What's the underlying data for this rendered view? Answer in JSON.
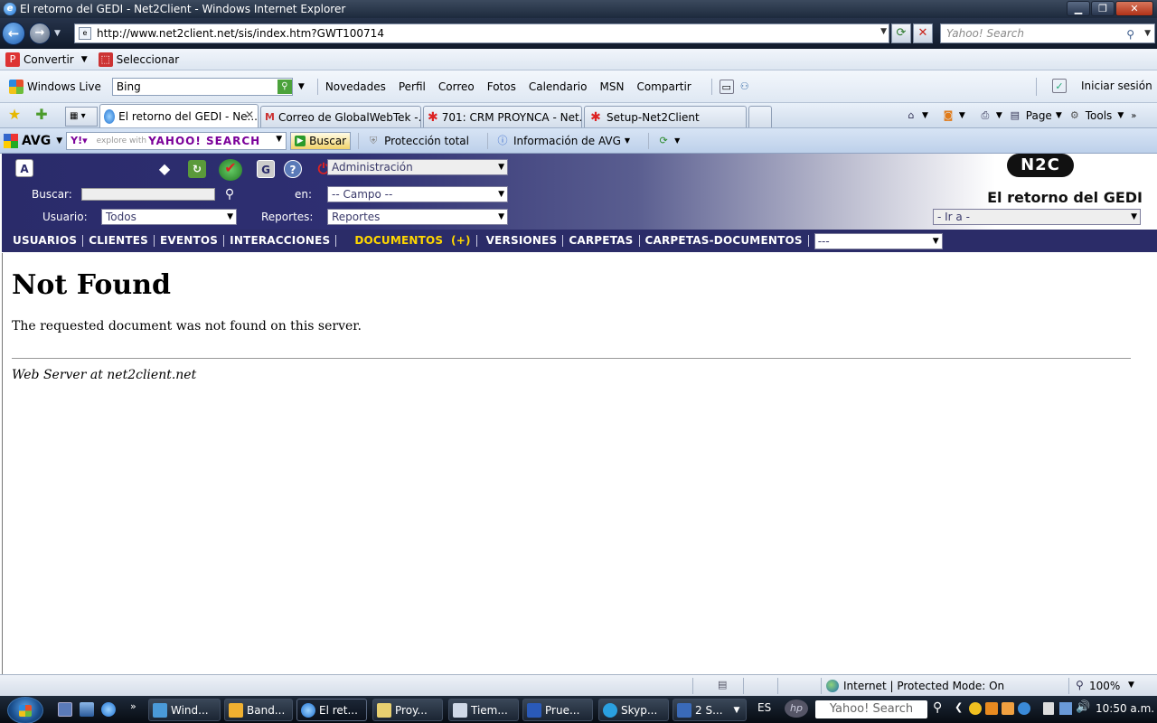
{
  "window": {
    "title": "El retorno del GEDI - Net2Client - Windows Internet Explorer"
  },
  "address": {
    "url": "http://www.net2client.net/sis/index.htm?GWT100714"
  },
  "search": {
    "placeholder": "Yahoo! Search"
  },
  "toolbar1": {
    "convert": "Convertir",
    "select": "Seleccionar"
  },
  "toolbar2": {
    "windows_live": "Windows Live",
    "bing": "Bing",
    "links": [
      "Novedades",
      "Perfil",
      "Correo",
      "Fotos",
      "Calendario",
      "MSN",
      "Compartir"
    ],
    "signin": "Iniciar sesión"
  },
  "tabs": [
    {
      "label": "El retorno del GEDI - Ne..."
    },
    {
      "label": "Correo de GlobalWebTek -..."
    },
    {
      "label": "701: CRM PROYNCA - Net..."
    },
    {
      "label": "Setup-Net2Client"
    }
  ],
  "ietools": {
    "page": "Page",
    "tools": "Tools"
  },
  "avg": {
    "brand": "AVG",
    "yahoo_explore": "explore with",
    "yahoo_logo": "YAHOO! SEARCH",
    "buscar": "Buscar",
    "proteccion": "Protección total",
    "info": "Información de AVG"
  },
  "app": {
    "title": "El retorno del GEDI",
    "logo": "N2C",
    "admin_select": "Administración",
    "buscar_label": "Buscar:",
    "en_label": "en:",
    "campo_select": "-- Campo --",
    "usuario_label": "Usuario:",
    "usuario_select": "Todos",
    "reportes_label": "Reportes:",
    "reportes_select": "Reportes",
    "ira_select": "- Ir a -",
    "menu": [
      "USUARIOS",
      "CLIENTES",
      "EVENTOS",
      "INTERACCIONES"
    ],
    "menu_highlight": "DOCUMENTOS  (+)",
    "menu2": [
      "VERSIONES",
      "CARPETAS",
      "CARPETAS-DOCUMENTOS"
    ],
    "menu_select": "---"
  },
  "page": {
    "heading": "Not Found",
    "message": "The requested document was not found on this server.",
    "footer": "Web Server at net2client.net"
  },
  "status": {
    "zone": "Internet | Protected Mode: On",
    "zoom": "100%"
  },
  "taskbar": {
    "tasks": [
      "Wind...",
      "Band...",
      "El ret...",
      "Proy...",
      "Tiem...",
      "Prue...",
      "Skyp...",
      "2 S..."
    ],
    "lang": "ES",
    "ysearch": "Yahoo! Search",
    "clock": "10:50 a.m."
  },
  "colors": {
    "header_dark": "#2b2c68",
    "menu_highlight": "#ffd700"
  }
}
